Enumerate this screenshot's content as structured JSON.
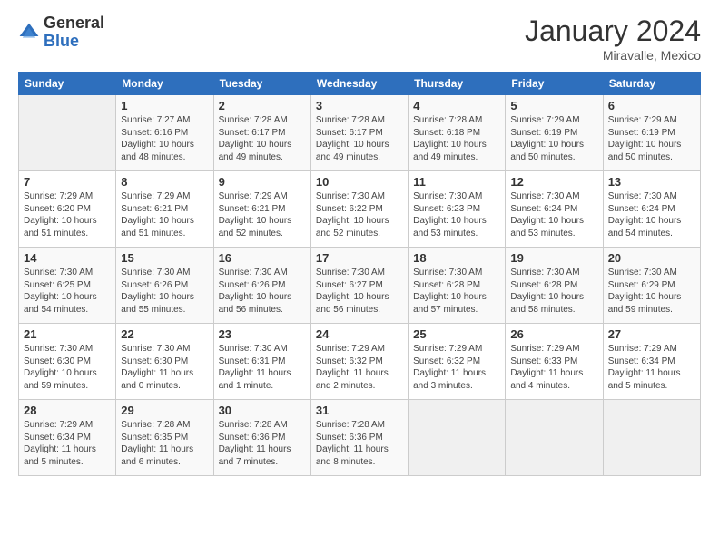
{
  "logo": {
    "general": "General",
    "blue": "Blue"
  },
  "title": "January 2024",
  "subtitle": "Miravalle, Mexico",
  "days_header": [
    "Sunday",
    "Monday",
    "Tuesday",
    "Wednesday",
    "Thursday",
    "Friday",
    "Saturday"
  ],
  "weeks": [
    [
      {
        "num": "",
        "info": ""
      },
      {
        "num": "1",
        "info": "Sunrise: 7:27 AM\nSunset: 6:16 PM\nDaylight: 10 hours\nand 48 minutes."
      },
      {
        "num": "2",
        "info": "Sunrise: 7:28 AM\nSunset: 6:17 PM\nDaylight: 10 hours\nand 49 minutes."
      },
      {
        "num": "3",
        "info": "Sunrise: 7:28 AM\nSunset: 6:17 PM\nDaylight: 10 hours\nand 49 minutes."
      },
      {
        "num": "4",
        "info": "Sunrise: 7:28 AM\nSunset: 6:18 PM\nDaylight: 10 hours\nand 49 minutes."
      },
      {
        "num": "5",
        "info": "Sunrise: 7:29 AM\nSunset: 6:19 PM\nDaylight: 10 hours\nand 50 minutes."
      },
      {
        "num": "6",
        "info": "Sunrise: 7:29 AM\nSunset: 6:19 PM\nDaylight: 10 hours\nand 50 minutes."
      }
    ],
    [
      {
        "num": "7",
        "info": "Sunrise: 7:29 AM\nSunset: 6:20 PM\nDaylight: 10 hours\nand 51 minutes."
      },
      {
        "num": "8",
        "info": "Sunrise: 7:29 AM\nSunset: 6:21 PM\nDaylight: 10 hours\nand 51 minutes."
      },
      {
        "num": "9",
        "info": "Sunrise: 7:29 AM\nSunset: 6:21 PM\nDaylight: 10 hours\nand 52 minutes."
      },
      {
        "num": "10",
        "info": "Sunrise: 7:30 AM\nSunset: 6:22 PM\nDaylight: 10 hours\nand 52 minutes."
      },
      {
        "num": "11",
        "info": "Sunrise: 7:30 AM\nSunset: 6:23 PM\nDaylight: 10 hours\nand 53 minutes."
      },
      {
        "num": "12",
        "info": "Sunrise: 7:30 AM\nSunset: 6:24 PM\nDaylight: 10 hours\nand 53 minutes."
      },
      {
        "num": "13",
        "info": "Sunrise: 7:30 AM\nSunset: 6:24 PM\nDaylight: 10 hours\nand 54 minutes."
      }
    ],
    [
      {
        "num": "14",
        "info": "Sunrise: 7:30 AM\nSunset: 6:25 PM\nDaylight: 10 hours\nand 54 minutes."
      },
      {
        "num": "15",
        "info": "Sunrise: 7:30 AM\nSunset: 6:26 PM\nDaylight: 10 hours\nand 55 minutes."
      },
      {
        "num": "16",
        "info": "Sunrise: 7:30 AM\nSunset: 6:26 PM\nDaylight: 10 hours\nand 56 minutes."
      },
      {
        "num": "17",
        "info": "Sunrise: 7:30 AM\nSunset: 6:27 PM\nDaylight: 10 hours\nand 56 minutes."
      },
      {
        "num": "18",
        "info": "Sunrise: 7:30 AM\nSunset: 6:28 PM\nDaylight: 10 hours\nand 57 minutes."
      },
      {
        "num": "19",
        "info": "Sunrise: 7:30 AM\nSunset: 6:28 PM\nDaylight: 10 hours\nand 58 minutes."
      },
      {
        "num": "20",
        "info": "Sunrise: 7:30 AM\nSunset: 6:29 PM\nDaylight: 10 hours\nand 59 minutes."
      }
    ],
    [
      {
        "num": "21",
        "info": "Sunrise: 7:30 AM\nSunset: 6:30 PM\nDaylight: 10 hours\nand 59 minutes."
      },
      {
        "num": "22",
        "info": "Sunrise: 7:30 AM\nSunset: 6:30 PM\nDaylight: 11 hours\nand 0 minutes."
      },
      {
        "num": "23",
        "info": "Sunrise: 7:30 AM\nSunset: 6:31 PM\nDaylight: 11 hours\nand 1 minute."
      },
      {
        "num": "24",
        "info": "Sunrise: 7:29 AM\nSunset: 6:32 PM\nDaylight: 11 hours\nand 2 minutes."
      },
      {
        "num": "25",
        "info": "Sunrise: 7:29 AM\nSunset: 6:32 PM\nDaylight: 11 hours\nand 3 minutes."
      },
      {
        "num": "26",
        "info": "Sunrise: 7:29 AM\nSunset: 6:33 PM\nDaylight: 11 hours\nand 4 minutes."
      },
      {
        "num": "27",
        "info": "Sunrise: 7:29 AM\nSunset: 6:34 PM\nDaylight: 11 hours\nand 5 minutes."
      }
    ],
    [
      {
        "num": "28",
        "info": "Sunrise: 7:29 AM\nSunset: 6:34 PM\nDaylight: 11 hours\nand 5 minutes."
      },
      {
        "num": "29",
        "info": "Sunrise: 7:28 AM\nSunset: 6:35 PM\nDaylight: 11 hours\nand 6 minutes."
      },
      {
        "num": "30",
        "info": "Sunrise: 7:28 AM\nSunset: 6:36 PM\nDaylight: 11 hours\nand 7 minutes."
      },
      {
        "num": "31",
        "info": "Sunrise: 7:28 AM\nSunset: 6:36 PM\nDaylight: 11 hours\nand 8 minutes."
      },
      {
        "num": "",
        "info": ""
      },
      {
        "num": "",
        "info": ""
      },
      {
        "num": "",
        "info": ""
      }
    ]
  ]
}
